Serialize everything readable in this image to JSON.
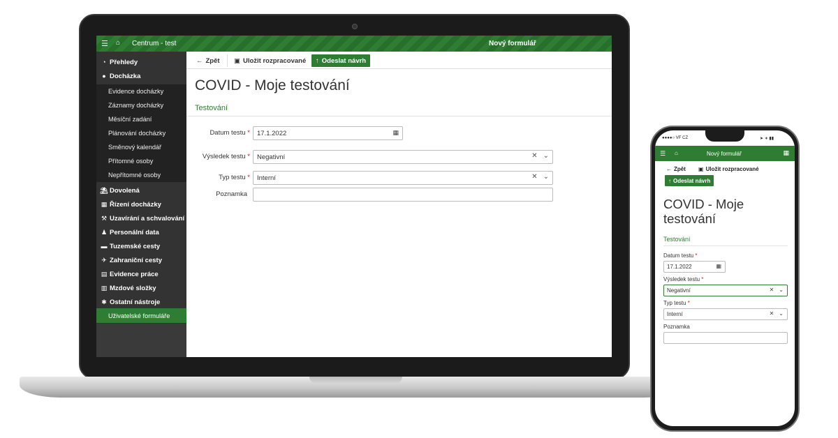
{
  "desktop": {
    "header": {
      "app_name": "Centrum - test",
      "form_title": "Nový formulář"
    },
    "sidebar": {
      "items": [
        {
          "label": "Přehledy",
          "icon": "dashboard-icon"
        },
        {
          "label": "Docházka",
          "icon": "clock-icon"
        },
        {
          "label": "Dovolená",
          "icon": "beach-icon"
        },
        {
          "label": "Řízení docházky",
          "icon": "calendar-icon"
        },
        {
          "label": "Uzavírání a schvalování",
          "icon": "gavel-icon"
        },
        {
          "label": "Personální data",
          "icon": "user-icon"
        },
        {
          "label": "Tuzemské cesty",
          "icon": "car-icon"
        },
        {
          "label": "Zahraniční cesty",
          "icon": "plane-icon"
        },
        {
          "label": "Evidence práce",
          "icon": "grid-icon"
        },
        {
          "label": "Mzdové složky",
          "icon": "money-icon"
        },
        {
          "label": "Ostatní nástroje",
          "icon": "gear-icon"
        }
      ],
      "subitems": [
        "Evidence docházky",
        "Záznamy docházky",
        "Měsíční zadání",
        "Plánování docházky",
        "Směnový kalendář",
        "Přítomné osoby",
        "Nepřítomné osoby"
      ],
      "active_item": "Uživatelské formuláře"
    },
    "toolbar": {
      "back": "Zpět",
      "save": "Uložit rozpracované",
      "submit": "Odeslat návrh"
    },
    "page_title": "COVID - Moje testování",
    "section": "Testování",
    "fields": {
      "date_label": "Datum testu",
      "date_value": "17.1.2022",
      "result_label": "Výsledek testu",
      "result_value": "Negativní",
      "type_label": "Typ testu",
      "type_value": "Interní",
      "note_label": "Poznamka",
      "note_value": ""
    }
  },
  "mobile": {
    "status": {
      "carrier": "●●●●○ VF CZ"
    },
    "header": {
      "form_title": "Nový formulář"
    },
    "toolbar": {
      "back": "Zpět",
      "save": "Uložit rozpracované",
      "submit": "Odeslat návrh"
    },
    "page_title": "COVID - Moje testování",
    "section": "Testování",
    "fields": {
      "date_label": "Datum testu",
      "date_value": "17.1.2022",
      "result_label": "Výsledek testu",
      "result_value": "Negativní",
      "type_label": "Typ testu",
      "type_value": "Interní",
      "note_label": "Poznamka",
      "note_value": ""
    }
  },
  "colors": {
    "brand_green": "#2e7d32",
    "sidebar_dark": "#333333",
    "required_red": "#c62828"
  }
}
